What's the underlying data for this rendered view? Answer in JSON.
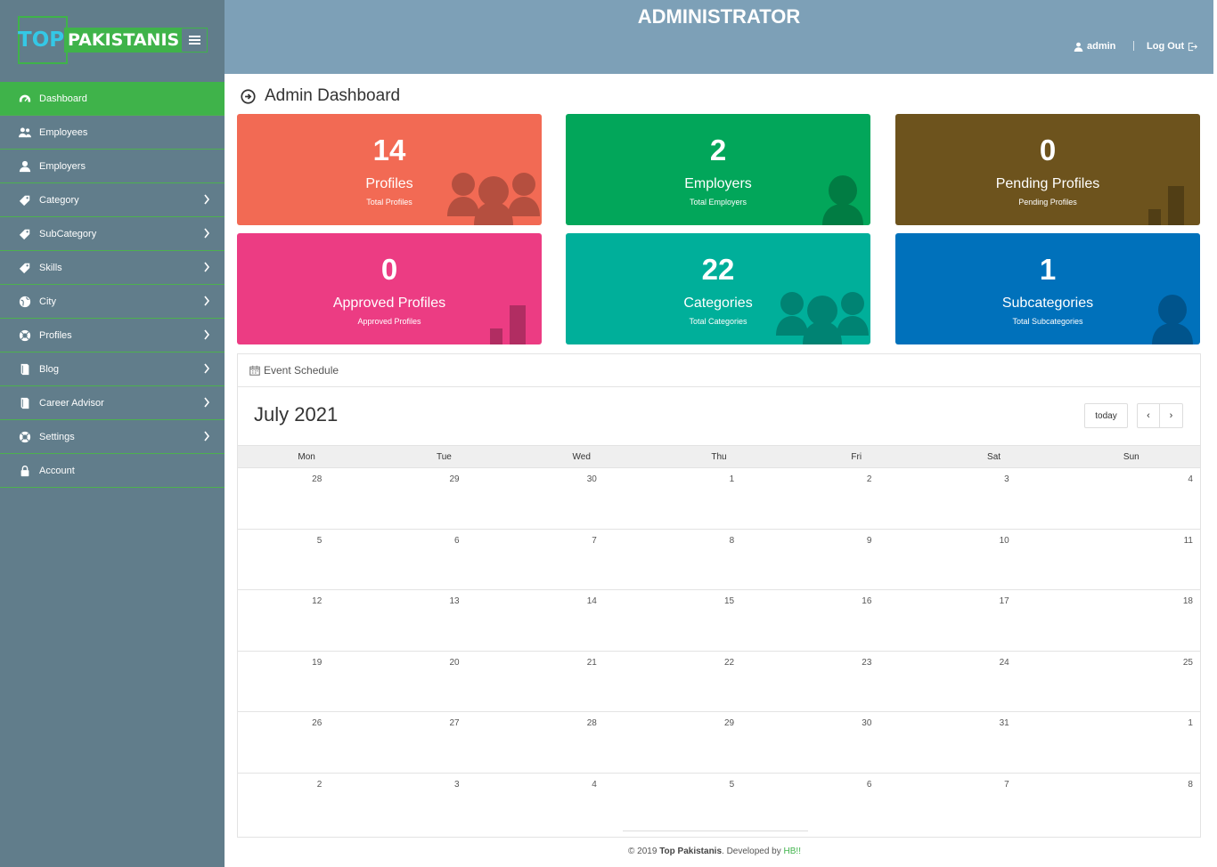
{
  "brand": {
    "top": "TOP",
    "pakistanis": "PAKISTANIS"
  },
  "colors": {
    "sidebar": "#617d8b",
    "accent": "#3fb34a",
    "header": "#7da0b7"
  },
  "sidebar": {
    "items": [
      {
        "label": "Dashboard",
        "icon": "dashboard-icon",
        "active": true,
        "has_chevron": false
      },
      {
        "label": "Employees",
        "icon": "users-icon",
        "active": false,
        "has_chevron": false
      },
      {
        "label": "Employers",
        "icon": "user-icon",
        "active": false,
        "has_chevron": false
      },
      {
        "label": "Category",
        "icon": "tag-icon",
        "active": false,
        "has_chevron": true
      },
      {
        "label": "SubCategory",
        "icon": "tag-icon",
        "active": false,
        "has_chevron": true
      },
      {
        "label": "Skills",
        "icon": "tag-icon",
        "active": false,
        "has_chevron": true
      },
      {
        "label": "City",
        "icon": "globe-icon",
        "active": false,
        "has_chevron": true
      },
      {
        "label": "Profiles",
        "icon": "lifebuoy-icon",
        "active": false,
        "has_chevron": true
      },
      {
        "label": "Blog",
        "icon": "book-icon",
        "active": false,
        "has_chevron": true
      },
      {
        "label": "Career Advisor",
        "icon": "book-icon",
        "active": false,
        "has_chevron": true
      },
      {
        "label": "Settings",
        "icon": "lifebuoy-icon",
        "active": false,
        "has_chevron": true
      },
      {
        "label": "Account",
        "icon": "lock-icon",
        "active": false,
        "has_chevron": false
      }
    ]
  },
  "header": {
    "title": "ADMINISTRATOR",
    "user": "admin",
    "logout": "Log Out"
  },
  "page": {
    "title": "Admin Dashboard"
  },
  "cards": [
    {
      "number": "14",
      "label": "Profiles",
      "sub": "Total Profiles",
      "color": "#f26a54",
      "deco": "group-icon"
    },
    {
      "number": "2",
      "label": "Employers",
      "sub": "Total Employers",
      "color": "#02a65a",
      "deco": "person-icon"
    },
    {
      "number": "0",
      "label": "Pending Profiles",
      "sub": "Pending Profiles",
      "color": "#6d531d",
      "deco": "bar-chart-icon"
    },
    {
      "number": "0",
      "label": "Approved Profiles",
      "sub": "Approved Profiles",
      "color": "#ec3c83",
      "deco": "bar-chart-icon"
    },
    {
      "number": "22",
      "label": "Categories",
      "sub": "Total Categories",
      "color": "#00af9a",
      "deco": "group-icon"
    },
    {
      "number": "1",
      "label": "Subcategories",
      "sub": "Total Subcategories",
      "color": "#0071bb",
      "deco": "person-icon"
    }
  ],
  "calendar": {
    "panel_title": "Event Schedule",
    "month": "July 2021",
    "today_label": "today",
    "prev_label": "‹",
    "next_label": "›",
    "weekdays": [
      "Mon",
      "Tue",
      "Wed",
      "Thu",
      "Fri",
      "Sat",
      "Sun"
    ],
    "weeks": [
      [
        "28",
        "29",
        "30",
        "1",
        "2",
        "3",
        "4"
      ],
      [
        "5",
        "6",
        "7",
        "8",
        "9",
        "10",
        "11"
      ],
      [
        "12",
        "13",
        "14",
        "15",
        "16",
        "17",
        "18"
      ],
      [
        "19",
        "20",
        "21",
        "22",
        "23",
        "24",
        "25"
      ],
      [
        "26",
        "27",
        "28",
        "29",
        "30",
        "31",
        "1"
      ],
      [
        "2",
        "3",
        "4",
        "5",
        "6",
        "7",
        "8"
      ]
    ]
  },
  "footer": {
    "prefix": "© 2019 ",
    "brand": "Top Pakistanis",
    "middle": ". Developed by ",
    "dev": "HB!!"
  }
}
